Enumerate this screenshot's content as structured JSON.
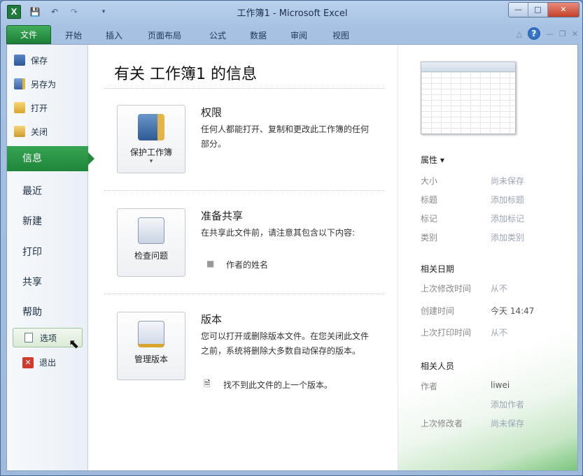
{
  "window": {
    "title": "工作簿1 - Microsoft Excel",
    "app_icon": "X",
    "controls": {
      "minimize": "—",
      "maximize": "□",
      "close": "✕"
    }
  },
  "ribbon": {
    "file_tab": "文件",
    "tabs": [
      "开始",
      "插入",
      "页面布局",
      "公式",
      "数据",
      "审阅",
      "视图"
    ],
    "help_icon": "?"
  },
  "nav": {
    "save": "保存",
    "save_as": "另存为",
    "open": "打开",
    "close": "关闭",
    "info": "信息",
    "recent": "最近",
    "new": "新建",
    "print": "打印",
    "share": "共享",
    "help": "帮助",
    "options": "选项",
    "exit": "退出"
  },
  "info": {
    "title": "有关 工作簿1 的信息",
    "permissions": {
      "button": "保护工作簿",
      "button_arrow": "▾",
      "title": "权限",
      "text": "任何人都能打开、复制和更改此工作簿的任何部分。"
    },
    "prepare": {
      "button": "检查问题",
      "title": "准备共享",
      "text": "在共享此文件前，请注意其包含以下内容:",
      "bullet": "作者的姓名"
    },
    "versions": {
      "button": "管理版本",
      "title": "版本",
      "text": "您可以打开或删除版本文件。在您关闭此文件之前，系统将删除大多数自动保存的版本。",
      "note": "找不到此文件的上一个版本。"
    }
  },
  "properties": {
    "heading": "属性 ▾",
    "rows": [
      {
        "key": "大小",
        "value": "尚未保存"
      },
      {
        "key": "标题",
        "value": "添加标题"
      },
      {
        "key": "标记",
        "value": "添加标记"
      },
      {
        "key": "类别",
        "value": "添加类别"
      }
    ],
    "dates_heading": "相关日期",
    "dates": [
      {
        "key": "上次修改时间",
        "value": "从不"
      },
      {
        "key": "创建时间",
        "value": "今天 14:47"
      },
      {
        "key": "上次打印时间",
        "value": "从不"
      }
    ],
    "people_heading": "相关人员",
    "author_key": "作者",
    "author_value": "liwei",
    "add_author": "添加作者",
    "modified_by_key": "上次修改者",
    "modified_by_value": "尚未保存"
  },
  "colors": {
    "file_green": "#1e8539",
    "accent_blue": "#1c54a8"
  }
}
